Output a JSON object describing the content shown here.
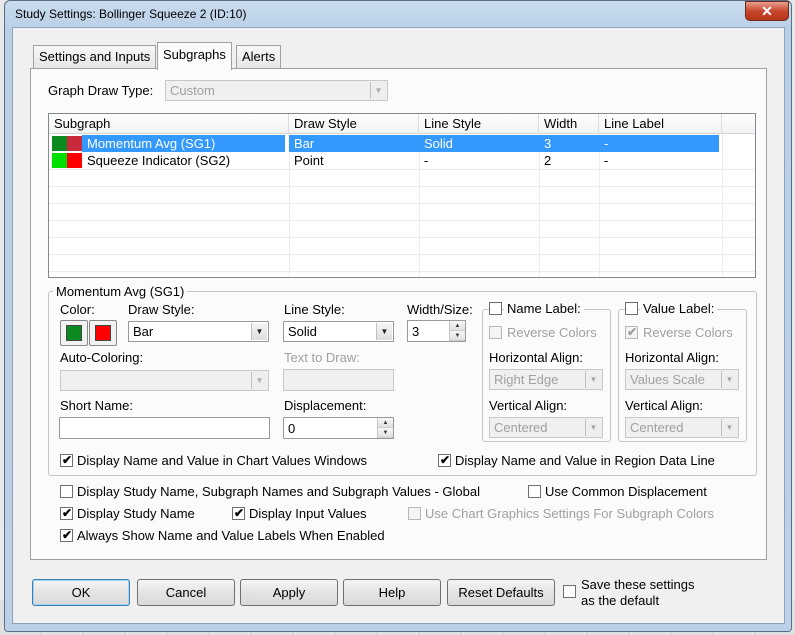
{
  "window": {
    "title": "Study Settings: Bollinger Squeeze 2 (ID:10)",
    "close_label": "✕"
  },
  "tabs": [
    {
      "label": "Settings and Inputs"
    },
    {
      "label": "Subgraphs"
    },
    {
      "label": "Alerts"
    }
  ],
  "graph_draw_type": {
    "label": "Graph Draw Type:",
    "value": "Custom"
  },
  "subgraph_table": {
    "headers": [
      "Subgraph",
      "Draw Style",
      "Line Style",
      "Width",
      "Line Label"
    ],
    "rows": [
      {
        "name": "Momentum Avg (SG1)",
        "draw_style": "Bar",
        "line_style": "Solid",
        "width": "3",
        "line_label": "-",
        "colors": [
          "#0b8a1f",
          "#c82a3c"
        ]
      },
      {
        "name": "Squeeze Indicator (SG2)",
        "draw_style": "Point",
        "line_style": "-",
        "width": "2",
        "line_label": "-",
        "colors": [
          "#00e000",
          "#ff0000"
        ]
      }
    ]
  },
  "group": {
    "title": "Momentum Avg (SG1)",
    "color_label": "Color:",
    "color1": "#0b8a1f",
    "color2": "#ff0000",
    "draw_style_label": "Draw Style:",
    "draw_style_value": "Bar",
    "line_style_label": "Line Style:",
    "line_style_value": "Solid",
    "width_label": "Width/Size:",
    "width_value": "3",
    "auto_coloring_label": "Auto-Coloring:",
    "auto_coloring_value": "",
    "text_to_draw_label": "Text to Draw:",
    "short_name_label": "Short Name:",
    "short_name_value": "",
    "displacement_label": "Displacement:",
    "displacement_value": "0",
    "name_label": {
      "title": "Name Label:",
      "reverse_colors": "Reverse Colors",
      "h_align_label": "Horizontal Align:",
      "h_align_value": "Right Edge",
      "v_align_label": "Vertical Align:",
      "v_align_value": "Centered"
    },
    "value_label": {
      "title": "Value Label:",
      "reverse_colors": "Reverse Colors",
      "h_align_label": "Horizontal Align:",
      "h_align_value": "Values Scale",
      "v_align_label": "Vertical Align:",
      "v_align_value": "Centered"
    },
    "display_chart_values": "Display Name and Value in Chart Values Windows",
    "display_region_data": "Display Name and Value in Region Data Line"
  },
  "options": {
    "global_display": "Display Study Name, Subgraph Names and Subgraph Values - Global",
    "common_displacement": "Use Common Displacement",
    "display_study_name": "Display Study Name",
    "display_input_values": "Display Input Values",
    "chart_graphics": "Use Chart Graphics Settings For Subgraph Colors",
    "always_show": "Always Show Name and Value Labels When Enabled"
  },
  "buttons": {
    "ok": "OK",
    "cancel": "Cancel",
    "apply": "Apply",
    "help": "Help",
    "reset": "Reset Defaults",
    "save_default_line1": "Save these settings",
    "save_default_line2": "as the default"
  },
  "icons": {
    "check": "✔",
    "combo_arrow": "▼",
    "spin_up": "▲",
    "spin_down": "▼"
  }
}
